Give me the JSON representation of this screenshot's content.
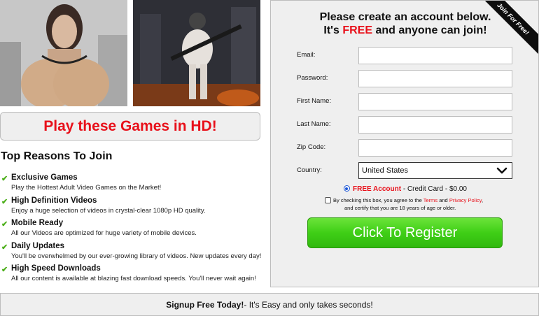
{
  "left": {
    "play_banner": "Play these Games in HD!",
    "reasons_title": "Top Reasons To Join",
    "reasons": [
      {
        "title": "Exclusive Games",
        "desc": "Play the Hottest Adult Video Games on the Market!"
      },
      {
        "title": "High Definition Videos",
        "desc": "Enjoy a huge selection of videos in crystal-clear 1080p HD quality."
      },
      {
        "title": "Mobile Ready",
        "desc": "All our Videos are optimized for huge variety of mobile devices."
      },
      {
        "title": "Daily Updates",
        "desc": "You'll be overwhelmed by our ever-growing library of videos. New updates every day!"
      },
      {
        "title": "High Speed Downloads",
        "desc": "All our content is available at blazing fast download speeds. You'll never wait again!"
      }
    ],
    "check_glyph": "✔"
  },
  "form": {
    "ribbon": "Join For Free!",
    "title_line1": "Please create an account below.",
    "title_line2_a": "It's ",
    "title_line2_free": "FREE",
    "title_line2_b": " and anyone can join!",
    "fields": [
      {
        "label": "Email:",
        "value": ""
      },
      {
        "label": "Password:",
        "value": ""
      },
      {
        "label": "First Name:",
        "value": ""
      },
      {
        "label": "Last Name:",
        "value": ""
      },
      {
        "label": "Zip Code:",
        "value": ""
      }
    ],
    "country_label": "Country:",
    "country_value": "United States",
    "plan_free": "FREE Account",
    "plan_rest": " - Credit Card - $0.00",
    "terms_a": "By checking this box, you agree to the ",
    "terms_link1": "Terms",
    "terms_b": " and ",
    "terms_link2": "Privacy Policy",
    "terms_c": ",",
    "terms_line2": "and certify that you are 18 years of age or older.",
    "register_button": "Click To Register"
  },
  "bottom": {
    "bold": "Signup Free Today!",
    "rest": " - It's Easy and only takes seconds!"
  },
  "colors": {
    "accent_red": "#e8101a",
    "button_green": "#3fcf16",
    "check_green": "#4caf1a"
  }
}
